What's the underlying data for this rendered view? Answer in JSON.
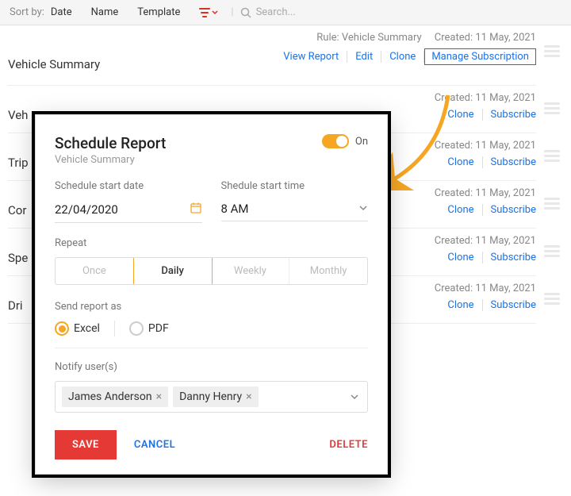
{
  "toolbar": {
    "sortby": "Sort by:",
    "opts": [
      "Date",
      "Name",
      "Template"
    ],
    "search_placeholder": "Search..."
  },
  "rows": [
    {
      "title": "Vehicle Summary",
      "rule": "Rule: Vehicle Summary",
      "created_label": "Created:",
      "created": "11 May, 2021",
      "actions": [
        "View Report",
        "Edit",
        "Clone",
        "Manage Subscription"
      ]
    },
    {
      "title": "Veh",
      "created_label": "Created:",
      "created": "11 May, 2021",
      "actions": [
        "Clone",
        "Subscribe"
      ]
    },
    {
      "title": "Trip",
      "created_label": "Created:",
      "created": "11 May, 2021",
      "actions": [
        "Clone",
        "Subscribe"
      ]
    },
    {
      "title": "Cor",
      "created_label": "Created:",
      "created": "11 May, 2021",
      "actions": [
        "Clone",
        "Subscribe"
      ]
    },
    {
      "title": "Spe",
      "created_label": "Created:",
      "created": "11 May, 2021",
      "actions": [
        "Clone",
        "Subscribe"
      ]
    },
    {
      "title": "Dri",
      "created_label": "Created:",
      "created": "11 May, 2021",
      "actions": [
        "Clone",
        "Subscribe"
      ]
    }
  ],
  "modal": {
    "title": "Schedule Report",
    "subtitle": "Vehicle Summary",
    "toggle": "On",
    "start_date_label": "Schedule start date",
    "start_date": "22/04/2020",
    "start_time_label": "Shedule start time",
    "start_time": "8 AM",
    "repeat_label": "Repeat",
    "repeat_opts": [
      "Once",
      "Daily",
      "Weekly",
      "Monthly"
    ],
    "repeat_selected": "Daily",
    "send_as_label": "Send report as",
    "format_opts": [
      "Excel",
      "PDF"
    ],
    "format_selected": "Excel",
    "notify_label": "Notify user(s)",
    "users": [
      "James Anderson",
      "Danny Henry"
    ],
    "save": "SAVE",
    "cancel": "CANCEL",
    "delete": "DELETE"
  }
}
